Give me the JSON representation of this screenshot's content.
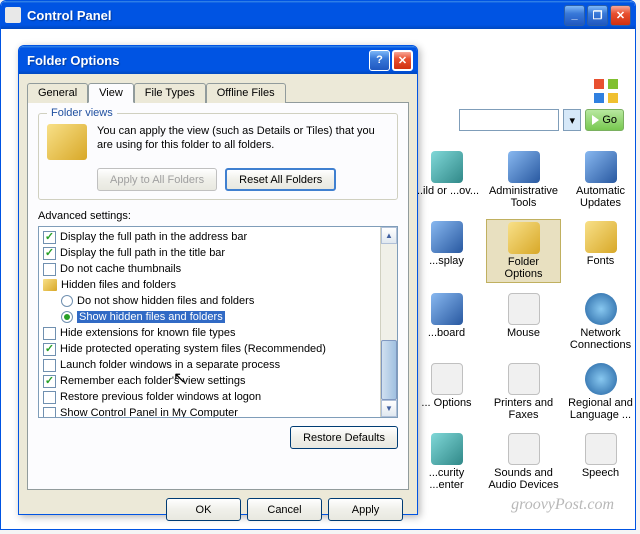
{
  "main_window": {
    "title": "Control Panel"
  },
  "addressbar": {
    "go": "Go"
  },
  "cp_items": [
    {
      "label": "...ild or\n...ov...",
      "cls": "teal"
    },
    {
      "label": "Administrative\nTools",
      "cls": "blue"
    },
    {
      "label": "Automatic\nUpdates",
      "cls": "blue"
    },
    {
      "label": "...splay",
      "cls": "blue"
    },
    {
      "label": "Folder Options",
      "cls": "folder"
    },
    {
      "label": "Fonts",
      "cls": "folder"
    },
    {
      "label": "...board",
      "cls": "blue"
    },
    {
      "label": "Mouse",
      "cls": "white"
    },
    {
      "label": "Network\nConnections",
      "cls": "globe"
    },
    {
      "label": "... Options",
      "cls": "white"
    },
    {
      "label": "Printers and\nFaxes",
      "cls": "white"
    },
    {
      "label": "Regional and\nLanguage ...",
      "cls": "globe"
    },
    {
      "label": "...curity\n...enter",
      "cls": "teal"
    },
    {
      "label": "Sounds and\nAudio Devices",
      "cls": "white"
    },
    {
      "label": "Speech",
      "cls": "white"
    }
  ],
  "dialog": {
    "title": "Folder Options",
    "tabs": [
      "General",
      "View",
      "File Types",
      "Offline Files"
    ],
    "active_tab": 1,
    "folder_views": {
      "legend": "Folder views",
      "text": "You can apply the view (such as Details or Tiles) that you are using for this folder to all folders.",
      "apply_btn": "Apply to All Folders",
      "reset_btn": "Reset All Folders"
    },
    "adv_label": "Advanced settings:",
    "tree": [
      {
        "type": "chk",
        "checked": true,
        "label": "Display the full path in the address bar",
        "indent": 0
      },
      {
        "type": "chk",
        "checked": true,
        "label": "Display the full path in the title bar",
        "indent": 0
      },
      {
        "type": "chk",
        "checked": false,
        "label": "Do not cache thumbnails",
        "indent": 0
      },
      {
        "type": "fld",
        "label": "Hidden files and folders",
        "indent": 0
      },
      {
        "type": "rdo",
        "checked": false,
        "label": "Do not show hidden files and folders",
        "indent": 1
      },
      {
        "type": "rdo",
        "checked": true,
        "label": "Show hidden files and folders",
        "indent": 1,
        "selected": true
      },
      {
        "type": "chk",
        "checked": false,
        "label": "Hide extensions for known file types",
        "indent": 0
      },
      {
        "type": "chk",
        "checked": true,
        "label": "Hide protected operating system files (Recommended)",
        "indent": 0
      },
      {
        "type": "chk",
        "checked": false,
        "label": "Launch folder windows in a separate process",
        "indent": 0
      },
      {
        "type": "chk",
        "checked": true,
        "label": "Remember each folder's view settings",
        "indent": 0
      },
      {
        "type": "chk",
        "checked": false,
        "label": "Restore previous folder windows at logon",
        "indent": 0
      },
      {
        "type": "chk",
        "checked": false,
        "label": "Show Control Panel in My Computer",
        "indent": 0
      }
    ],
    "restore_btn": "Restore Defaults",
    "ok": "OK",
    "cancel": "Cancel",
    "apply": "Apply"
  },
  "watermark": "groovyPost.com"
}
